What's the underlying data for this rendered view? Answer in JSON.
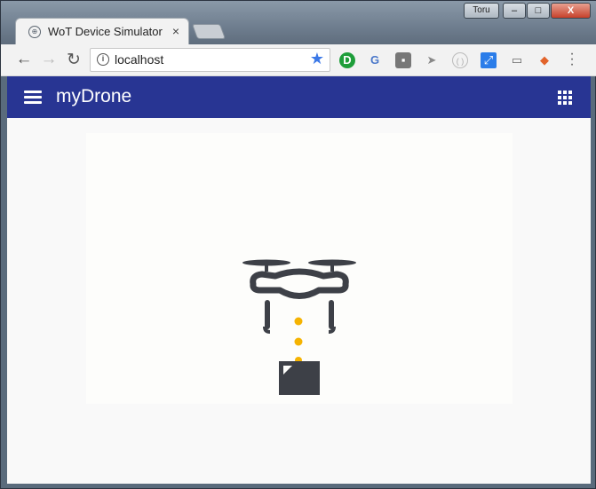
{
  "window": {
    "user": "Toru",
    "minimize_glyph": "–",
    "maximize_glyph": "□",
    "close_glyph": "X"
  },
  "browser": {
    "tab_title": "WoT Device Simulator",
    "tab_close_glyph": "×",
    "url": "localhost",
    "icons": [
      "globe-icon",
      "back-icon",
      "forward-icon",
      "reload-icon",
      "info-icon",
      "star-icon",
      "extension-icons",
      "menu-icon"
    ]
  },
  "app": {
    "title": "myDrone",
    "accent_color": "#283593",
    "icons": [
      "hamburger-menu-icon",
      "apps-grid-icon",
      "drone-icon",
      "package-icon"
    ]
  },
  "scene": {
    "drone_color": "#3d4047",
    "dot_color": "#f5b301"
  }
}
